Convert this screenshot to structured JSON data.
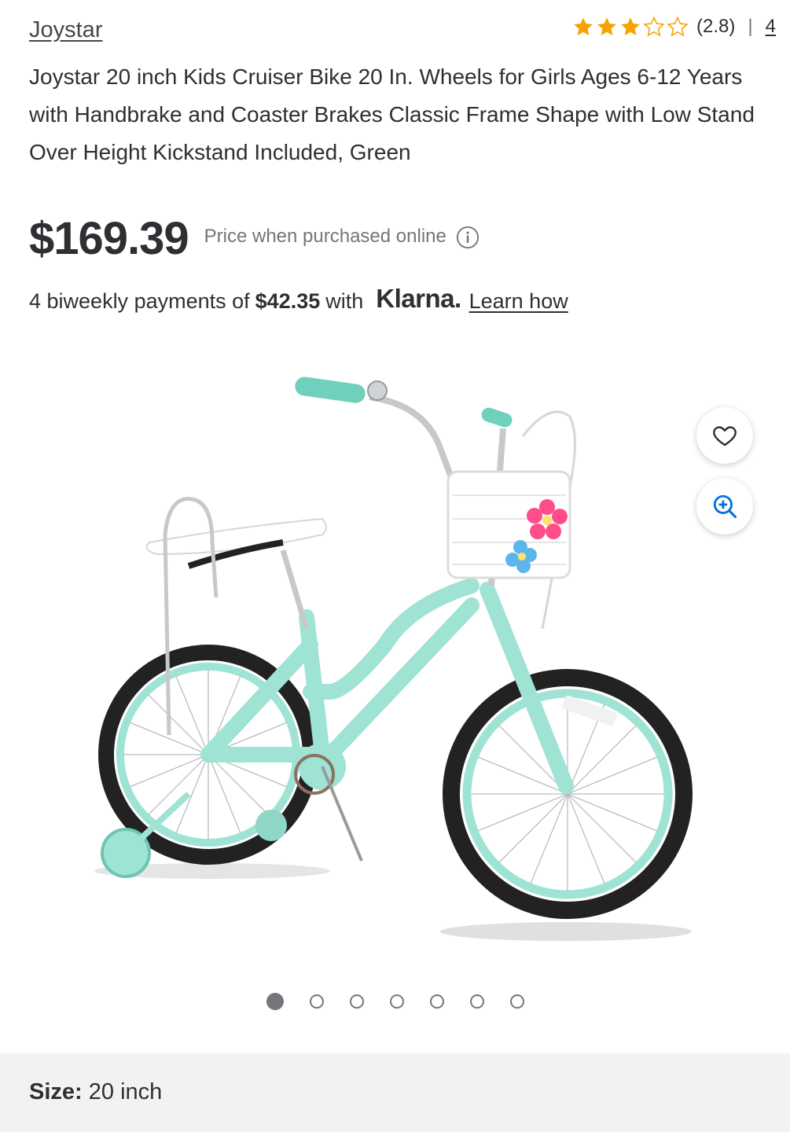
{
  "brand": "Joystar",
  "rating": {
    "value": 2.8,
    "stars_filled": 3,
    "stars_total": 5,
    "text": "(2.8)",
    "separator": "|",
    "review_count": "4"
  },
  "title": "Joystar 20 inch Kids Cruiser Bike 20 In. Wheels for Girls Ages 6-12 Years with Handbrake and Coaster Brakes Classic Frame Shape with Low Stand Over Height Kickstand Included, Green",
  "price": {
    "amount": "$169.39",
    "note": "Price when purchased online"
  },
  "payments": {
    "prefix": "4 biweekly payments of",
    "amount": "$42.35",
    "with": "with",
    "provider": "Klarna.",
    "link": "Learn how"
  },
  "gallery": {
    "total_images": 7,
    "active_index": 0
  },
  "size": {
    "label": "Size:",
    "value": "20 inch"
  },
  "colors": {
    "star": "#f5a300",
    "text": "#2e2f32",
    "muted": "#74767c",
    "bike": "#9fe3d4",
    "zoom_icon": "#0071dc"
  }
}
